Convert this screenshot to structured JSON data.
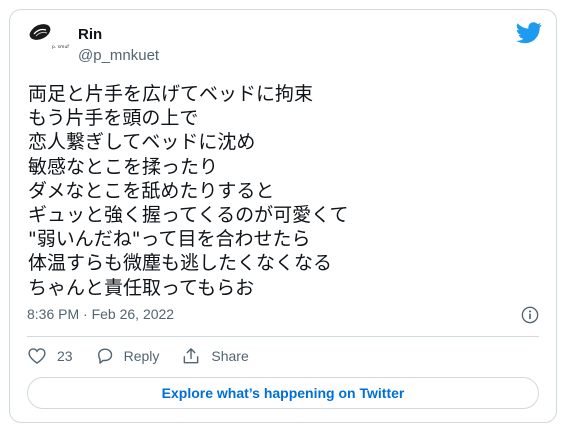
{
  "user": {
    "name": "Rin",
    "handle": "@p_mnkuet",
    "avatar_text": "p. smuf"
  },
  "tweet": {
    "lines": [
      "両足と片手を広げてベッドに拘束",
      "もう片手を頭の上で",
      "恋人繋ぎしてベッドに沈め",
      "敏感なとこを揉ったり",
      "ダメなとこを舐めたりすると",
      "ギュッと強く握ってくるのが可愛くて",
      "\"弱いんだね\"って目を合わせたら",
      "体温すらも微塵も逃したくなくなる",
      "ちゃんと責任取ってもらお"
    ],
    "timestamp": "8:36 PM · Feb 26, 2022"
  },
  "actions": {
    "like_count": "23",
    "reply_label": "Reply",
    "share_label": "Share"
  },
  "explore_label": "Explore what’s happening on Twitter",
  "colors": {
    "twitter_blue": "#1d9bf0",
    "link_blue": "#006fd6",
    "text": "#0f1419",
    "secondary": "#536471",
    "border": "#cfd9de"
  }
}
